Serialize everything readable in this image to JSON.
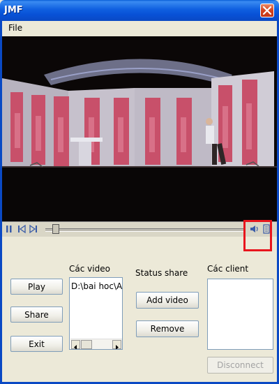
{
  "window": {
    "title": "JMF"
  },
  "menu": {
    "items": [
      "File"
    ]
  },
  "player": {
    "selected_file": "D:\\bai hoc\\A H"
  },
  "sections": {
    "videos_label": "Các video",
    "status_label": "Status share",
    "clients_label": "Các client"
  },
  "buttons": {
    "play": "Play",
    "share": "Share",
    "exit": "Exit",
    "add_video": "Add video",
    "remove": "Remove",
    "disconnect": "Disconnect"
  }
}
